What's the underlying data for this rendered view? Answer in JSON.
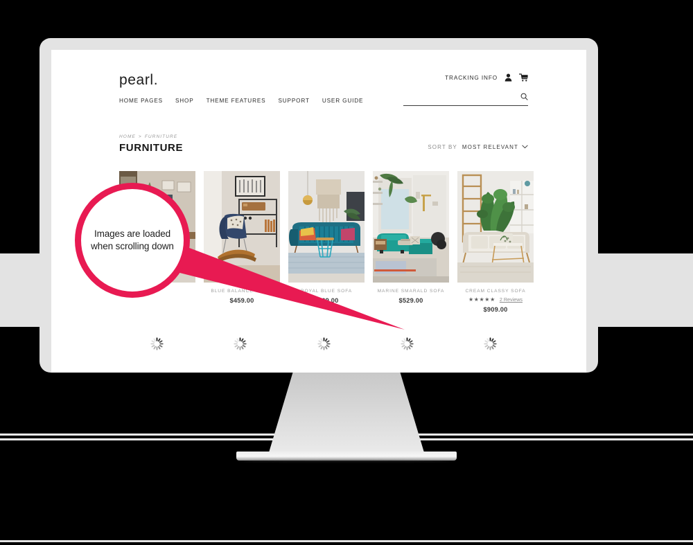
{
  "site": {
    "brand": "pearl.",
    "nav": [
      {
        "label": "HOME PAGES"
      },
      {
        "label": "SHOP"
      },
      {
        "label": "THEME FEATURES"
      },
      {
        "label": "SUPPORT"
      },
      {
        "label": "USER GUIDE"
      }
    ],
    "tracking_label": "TRACKING INFO",
    "account_icon": "user-icon",
    "cart_icon": "cart-icon",
    "search": {
      "icon": "search-icon",
      "value": "",
      "placeholder": ""
    }
  },
  "breadcrumb": {
    "home": "HOME",
    "separator": ">",
    "current": "FURNITURE"
  },
  "page_title": "FURNITURE",
  "sort": {
    "label": "SORT BY",
    "value": "MOST RELEVANT",
    "chevron_icon": "chevron-down-icon",
    "options": [
      "MOST RELEVANT"
    ]
  },
  "products": [
    {
      "name": "",
      "price": "",
      "image_alt": "dining room with plants",
      "rating": null,
      "reviews": null
    },
    {
      "name": "BLUE BALANCE CHAIR",
      "price": "$459.00",
      "image_alt": "blue rocking lounge chair",
      "rating": null,
      "reviews": null
    },
    {
      "name": "ROYAL BLUE SOFA",
      "price": "$769.00",
      "image_alt": "royal blue velvet sofa with macrame",
      "rating": null,
      "reviews": null
    },
    {
      "name": "MARINE SMARALD SOFA",
      "price": "$529.00",
      "image_alt": "teal sectional sofa in bright room",
      "rating": null,
      "reviews": null
    },
    {
      "name": "CREAM CLASSY SOFA",
      "price": "$909.00",
      "image_alt": "cream sofa with fiddle leaf fig",
      "rating": "★★★★★",
      "reviews": "2 Reviews"
    }
  ],
  "loaders": [
    {
      "icon": "loading-spinner-icon"
    },
    {
      "icon": "loading-spinner-icon"
    },
    {
      "icon": "loading-spinner-icon"
    },
    {
      "icon": "loading-spinner-icon"
    },
    {
      "icon": "loading-spinner-icon"
    }
  ],
  "callout": {
    "line1": "Images are loaded",
    "line2": "when scrolling down",
    "accent_color": "#e81a52"
  },
  "theme": {
    "background": "#000000",
    "bezel": "#e3e3e3",
    "screen": "#ffffff",
    "accent": "#e81a52"
  }
}
